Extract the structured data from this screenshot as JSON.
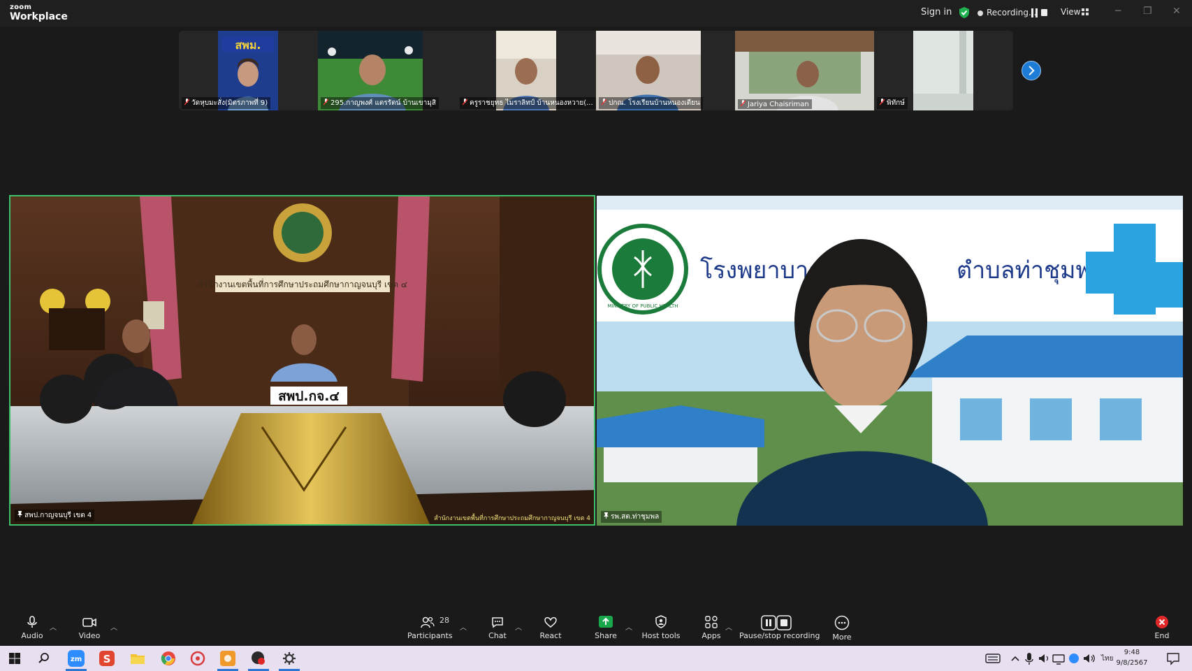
{
  "app": {
    "brand_small": "zoom",
    "brand_big": "Workplace"
  },
  "titlebar": {
    "sign_in": "Sign in",
    "recording": "Recording...",
    "view": "View"
  },
  "participants_strip": [
    {
      "name": "วัดหุบมะสั่ง(มิตรภาพที่ 9)"
    },
    {
      "name": "295.กาญพงศ์ แตรรัตน์ บ้านเขามุสิ"
    },
    {
      "name": "ครูราชยุทธ ไมราลิทป์ บ้านหนองหวาย(..."
    },
    {
      "name": "ปกณ. โรงเรียนบ้านหนองเตียน"
    },
    {
      "name": "Jariya Chaisriman"
    },
    {
      "name": "พิทักษ์"
    }
  ],
  "main_left": {
    "name": "สพป.กาญจนบุรี เขต 4",
    "sign_banner": "สำนักงานเขตพื้นที่การศึกษาประถมศึกษากาญจนบุรี เขต ๔",
    "desk_sign": "สพป.กจ.๔",
    "watermark": "สำนักงานเขตพื้นที่การศึกษาประถมศึกษากาญจนบุรี เขต 4"
  },
  "main_right": {
    "name": "รพ.สต.ท่าชุมพล",
    "banner_text_left": "โรงพยาบาล",
    "banner_text_right": "ตำบลท่าชุมพล",
    "seal_text": "MINISTRY OF PUBLIC HEALTH"
  },
  "toolbar": {
    "audio": "Audio",
    "video": "Video",
    "participants": "Participants",
    "participants_count": "28",
    "chat": "Chat",
    "react": "React",
    "share": "Share",
    "host_tools": "Host tools",
    "apps": "Apps",
    "pause_stop": "Pause/stop recording",
    "more": "More",
    "end": "End"
  },
  "taskbar": {
    "time": "9:48",
    "date": "9/8/2567",
    "lang": "ไทย"
  },
  "colors": {
    "active_speaker": "#3ec06a",
    "share_green": "#1aa64b",
    "end_red": "#e02828",
    "accent_blue": "#1c7cd6"
  }
}
